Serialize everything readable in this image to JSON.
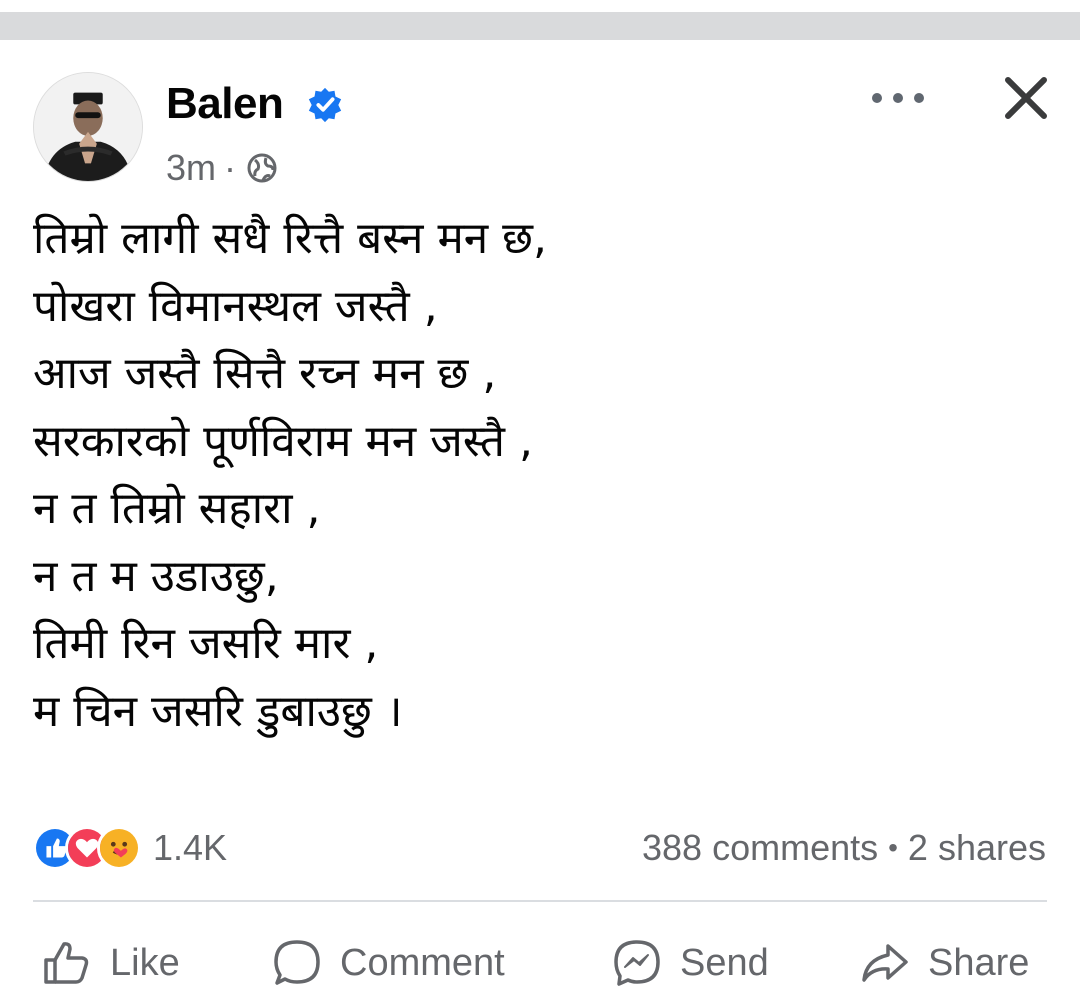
{
  "post": {
    "author": "Balen",
    "timestamp": "3m",
    "audience_icon": "globe-icon",
    "verified_icon": "verified-badge-icon",
    "lines": [
      "तिम्रो लागी सधै रित्तै बस्न मन छ,",
      "पोखरा विमानस्थल जस्तै ,",
      "आज जस्तै सित्तै रच्न मन छ ,",
      "सरकारको पूर्णविराम मन जस्तै ,",
      "न त तिम्रो सहारा ,",
      "न त म उडाउछु,",
      "तिमी रिन जसरि मार ,",
      "म चिन जसरि डुबाउछु ।"
    ]
  },
  "stats": {
    "reaction_icons": [
      "like-reaction-icon",
      "love-reaction-icon",
      "care-reaction-icon"
    ],
    "reaction_count": "1.4K",
    "comments": "388 comments",
    "separator": "•",
    "shares": "2 shares"
  },
  "actions": {
    "like": "Like",
    "comment": "Comment",
    "send": "Send",
    "share": "Share"
  },
  "colors": {
    "accent": "#1877f2",
    "secondary_text": "#65676b",
    "love": "#f33e58",
    "care": "#f7b125"
  }
}
